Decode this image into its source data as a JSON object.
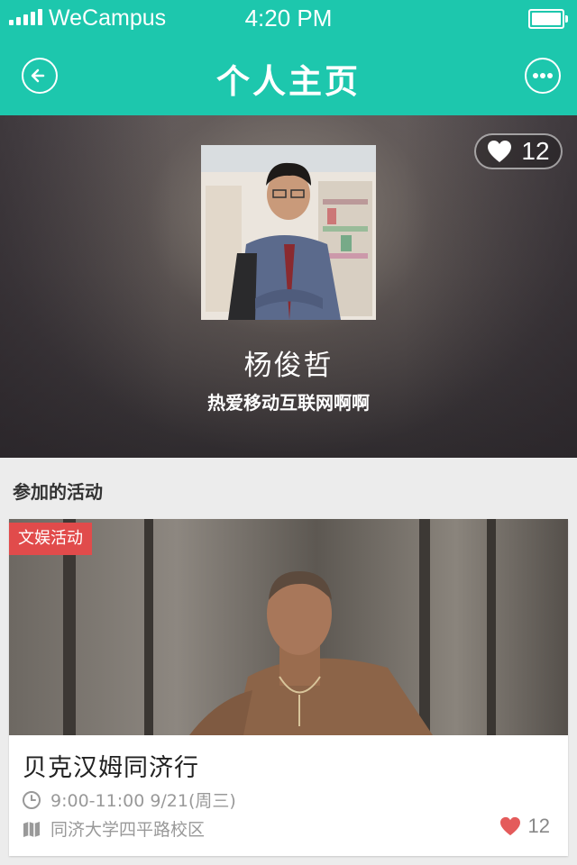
{
  "status_bar": {
    "carrier": "WeCampus",
    "time": "4:20 PM"
  },
  "nav": {
    "title": "个人主页",
    "back_icon": "back-arrow-icon",
    "more_icon": "more-dots-icon"
  },
  "profile": {
    "name": "杨俊哲",
    "bio": "热爱移动互联网啊啊",
    "likes": "12"
  },
  "activities": {
    "section_title": "参加的活动",
    "items": [
      {
        "category": "文娱活动",
        "title": "贝克汉姆同济行",
        "time": "9:00-11:00 9/21(周三)",
        "location": "同济大学四平路校区",
        "likes": "12"
      }
    ]
  },
  "colors": {
    "accent": "#1dc7ad",
    "tag": "#e14b4b",
    "heart": "#e45b5b"
  }
}
